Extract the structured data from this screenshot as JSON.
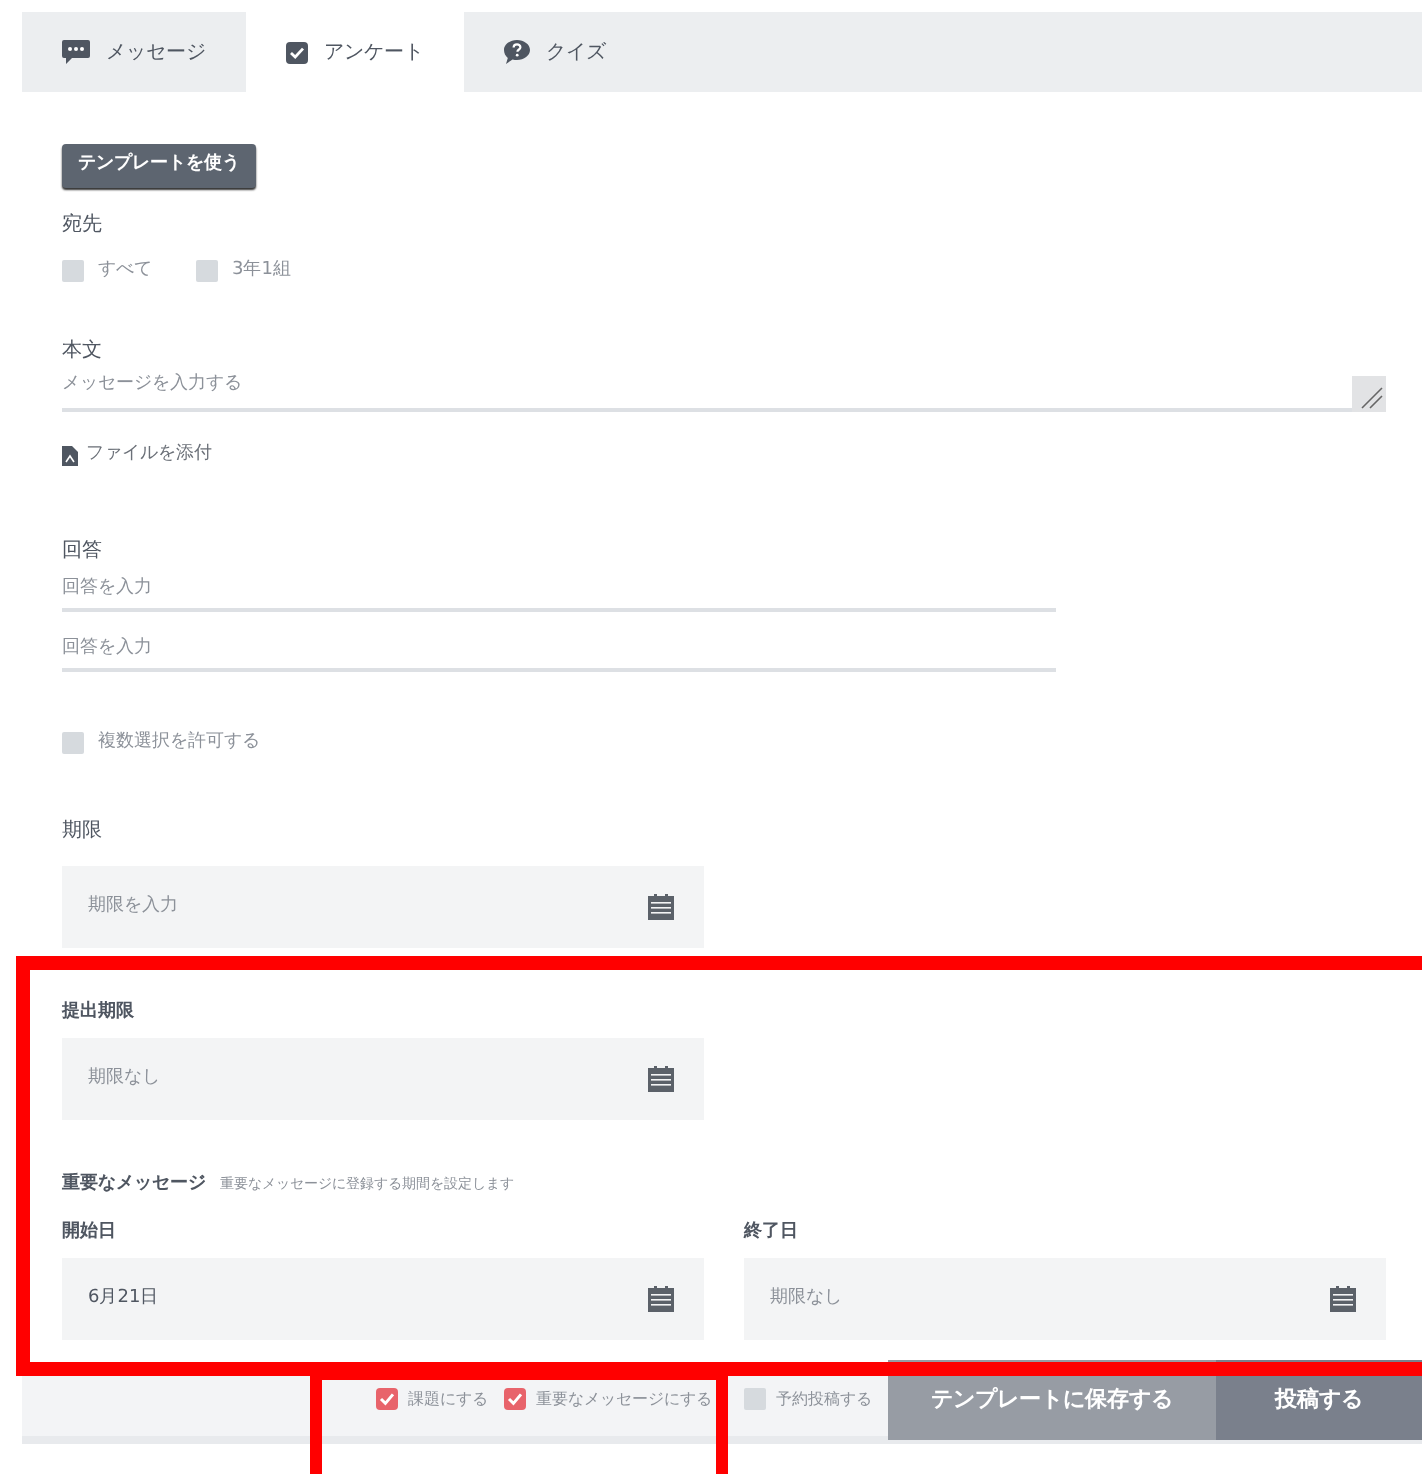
{
  "tabs": [
    {
      "label": "メッセージ",
      "selected": false
    },
    {
      "label": "アンケート",
      "selected": true
    },
    {
      "label": "クイズ",
      "selected": false
    }
  ],
  "template_button": "テンプレートを使う",
  "recipients": {
    "label": "宛先",
    "options": [
      {
        "label": "すべて",
        "checked": false
      },
      {
        "label": "3年1組",
        "checked": false
      }
    ]
  },
  "body": {
    "label": "本文",
    "placeholder": "メッセージを入力する"
  },
  "attach": "ファイルを添付",
  "answers": {
    "label": "回答",
    "fields": [
      {
        "placeholder": "回答を入力"
      },
      {
        "placeholder": "回答を入力"
      }
    ]
  },
  "multiple": {
    "label": "複数選択を許可する",
    "checked": false
  },
  "deadline": {
    "label": "期限",
    "placeholder": "期限を入力"
  },
  "submit_deadline": {
    "label": "提出期限",
    "placeholder": "期限なし"
  },
  "important": {
    "label": "重要なメッセージ",
    "note": "重要なメッセージに登録する期間を設定します",
    "start": {
      "label": "開始日",
      "value": "6月21日"
    },
    "end": {
      "label": "終了日",
      "placeholder": "期限なし"
    }
  },
  "footer": {
    "options": [
      {
        "label": "課題にする",
        "checked": true
      },
      {
        "label": "重要なメッセージにする",
        "checked": true
      },
      {
        "label": "予約投稿する",
        "checked": false
      }
    ],
    "buttons": [
      {
        "label": "テンプレートに保存する",
        "kind": "secondary"
      },
      {
        "label": "投稿する",
        "kind": "primary"
      }
    ]
  }
}
